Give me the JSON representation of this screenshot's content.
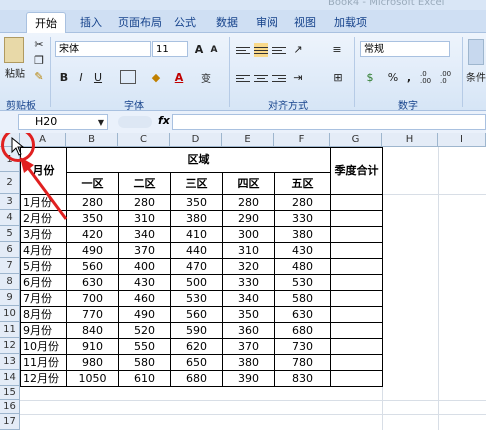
{
  "window": {
    "title": "Book4 - Microsoft Excel"
  },
  "tabs": [
    "开始",
    "插入",
    "页面布局",
    "公式",
    "数据",
    "审阅",
    "视图",
    "加载项"
  ],
  "ribbon": {
    "clipboard": {
      "paste_label": "粘贴",
      "group_label": "剪贴板"
    },
    "font": {
      "name": "宋体",
      "size": "11",
      "bold": "B",
      "italic": "I",
      "underline": "U",
      "grow": "A",
      "shrink": "A",
      "font_color_glyph": "A",
      "phonetic_glyph": "变",
      "group_label": "字体"
    },
    "alignment": {
      "group_label": "对齐方式"
    },
    "number": {
      "format": "常规",
      "currency": "$",
      "percent": "%",
      "comma": ",",
      "inc_decimal": ".0 .00",
      "dec_decimal": ".00 .0",
      "group_label": "数字"
    },
    "styles": {
      "label": "条件"
    }
  },
  "formula_bar": {
    "name_box": "H20",
    "fx": "fx",
    "content": ""
  },
  "columns": [
    "A",
    "B",
    "C",
    "D",
    "E",
    "F",
    "G",
    "H",
    "I"
  ],
  "rows": [
    "1",
    "2",
    "3",
    "4",
    "5",
    "6",
    "7",
    "8",
    "9",
    "10",
    "11",
    "12",
    "13",
    "14",
    "15",
    "16",
    "17"
  ],
  "sheet": {
    "month_header": "月份",
    "region_header": "区域",
    "total_header": "季度合计",
    "region_names": [
      "一区",
      "二区",
      "三区",
      "四区",
      "五区"
    ],
    "data": [
      {
        "month": "1月份",
        "values": [
          "280",
          "280",
          "350",
          "280",
          "280"
        ]
      },
      {
        "month": "2月份",
        "values": [
          "350",
          "310",
          "380",
          "290",
          "330"
        ]
      },
      {
        "month": "3月份",
        "values": [
          "420",
          "340",
          "410",
          "300",
          "380"
        ]
      },
      {
        "month": "4月份",
        "values": [
          "490",
          "370",
          "440",
          "310",
          "430"
        ]
      },
      {
        "month": "5月份",
        "values": [
          "560",
          "400",
          "470",
          "320",
          "480"
        ]
      },
      {
        "month": "6月份",
        "values": [
          "630",
          "430",
          "500",
          "330",
          "530"
        ]
      },
      {
        "month": "7月份",
        "values": [
          "700",
          "460",
          "530",
          "340",
          "580"
        ]
      },
      {
        "month": "8月份",
        "values": [
          "770",
          "490",
          "560",
          "350",
          "630"
        ]
      },
      {
        "month": "9月份",
        "values": [
          "840",
          "520",
          "590",
          "360",
          "680"
        ]
      },
      {
        "month": "10月份",
        "values": [
          "910",
          "550",
          "620",
          "370",
          "730"
        ]
      },
      {
        "month": "11月份",
        "values": [
          "980",
          "580",
          "650",
          "380",
          "780"
        ]
      },
      {
        "month": "12月份",
        "values": [
          "1050",
          "610",
          "680",
          "390",
          "830"
        ]
      }
    ]
  },
  "annotation": {
    "color": "#e02020"
  }
}
